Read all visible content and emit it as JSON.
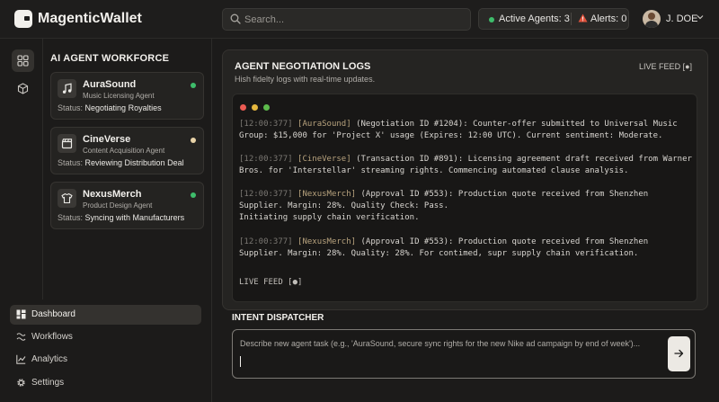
{
  "app": {
    "name": "MagenticWallet"
  },
  "search": {
    "placeholder": "Search..."
  },
  "header": {
    "active_agents": "Active Agents: 3",
    "alerts": "Alerts: 0",
    "user_name": "J. DOE"
  },
  "sidebar": {
    "section_title": "AI AGENT WORKFORCE",
    "status_prefix": "Status:",
    "agents": [
      {
        "name": "AuraSound",
        "role": "Music Licensing Agent",
        "status": "Negotiating Royalties",
        "icon": "music-note-icon",
        "dot_color": "#3ebd6b"
      },
      {
        "name": "CineVerse",
        "role": "Content Acquisition Agent",
        "status": "Reviewing Distribution Deal",
        "icon": "film-clapper-icon",
        "dot_color": "#e8d3a8"
      },
      {
        "name": "NexusMerch",
        "role": "Product Design Agent",
        "status": "Syncing with Manufacturers",
        "icon": "tshirt-icon",
        "dot_color": "#3ebd6b"
      }
    ],
    "nav": [
      {
        "label": "Dashboard",
        "icon": "dashboard-grid-icon",
        "active": true
      },
      {
        "label": "Workflows",
        "icon": "workflow-icon",
        "active": false
      },
      {
        "label": "Analytics",
        "icon": "line-chart-icon",
        "active": false
      },
      {
        "label": "Settings",
        "icon": "gear-icon",
        "active": false
      }
    ]
  },
  "logs": {
    "title": "AGENT NEGOTIATION LOGS",
    "subtitle": "Hish fidelty logs with real-time updates.",
    "live_feed_label": "LIVE FEED [●]",
    "entries": [
      {
        "timestamp": "[12:00:377]",
        "agent": "[AuraSound]",
        "text": "(Negotiation ID #1204): Counter-offer submitted to Universal Music Group: $15,000 for 'Project X' usage (Expires: 12:00 UTC). Current sentiment: Moderate."
      },
      {
        "timestamp": "[12:00:377]",
        "agent": "[CineVerse]",
        "text": "(Transaction ID #891): Licensing agreement draft received from Warner Bros. for 'Interstellar' streaming rights. Commencing automated clause analysis."
      },
      {
        "timestamp": "[12:00:377]",
        "agent": "[NexusMerch]",
        "text": "(Approval ID #553): Production quote received from Shenzhen Supplier. Margin: 28%. Quality Check: Pass.",
        "text2": "Initiating supply chain verification."
      },
      {
        "timestamp": "[12:00:377]",
        "agent": "[NexusMerch]",
        "text": "(Approval ID #553): Production quote received from Shenzhen Supplier. Margin: 28%. Quality: 28%. For contimed, supr supply chain verification."
      }
    ],
    "live_feed_footer": "LIVE FEED [●]"
  },
  "intent": {
    "title": "INTENT DISPATCHER",
    "placeholder": "Describe new agent task (e.g., 'AuraSound, secure sync rights for the new Nike ad campaign by end of week')..."
  },
  "colors": {
    "status_green": "#3ebd6b",
    "status_cream": "#e8d3a8",
    "alert_red": "#e0533d",
    "mac_red": "#ec5b53",
    "mac_yellow": "#e5b73e",
    "mac_green": "#5dbb4c"
  }
}
